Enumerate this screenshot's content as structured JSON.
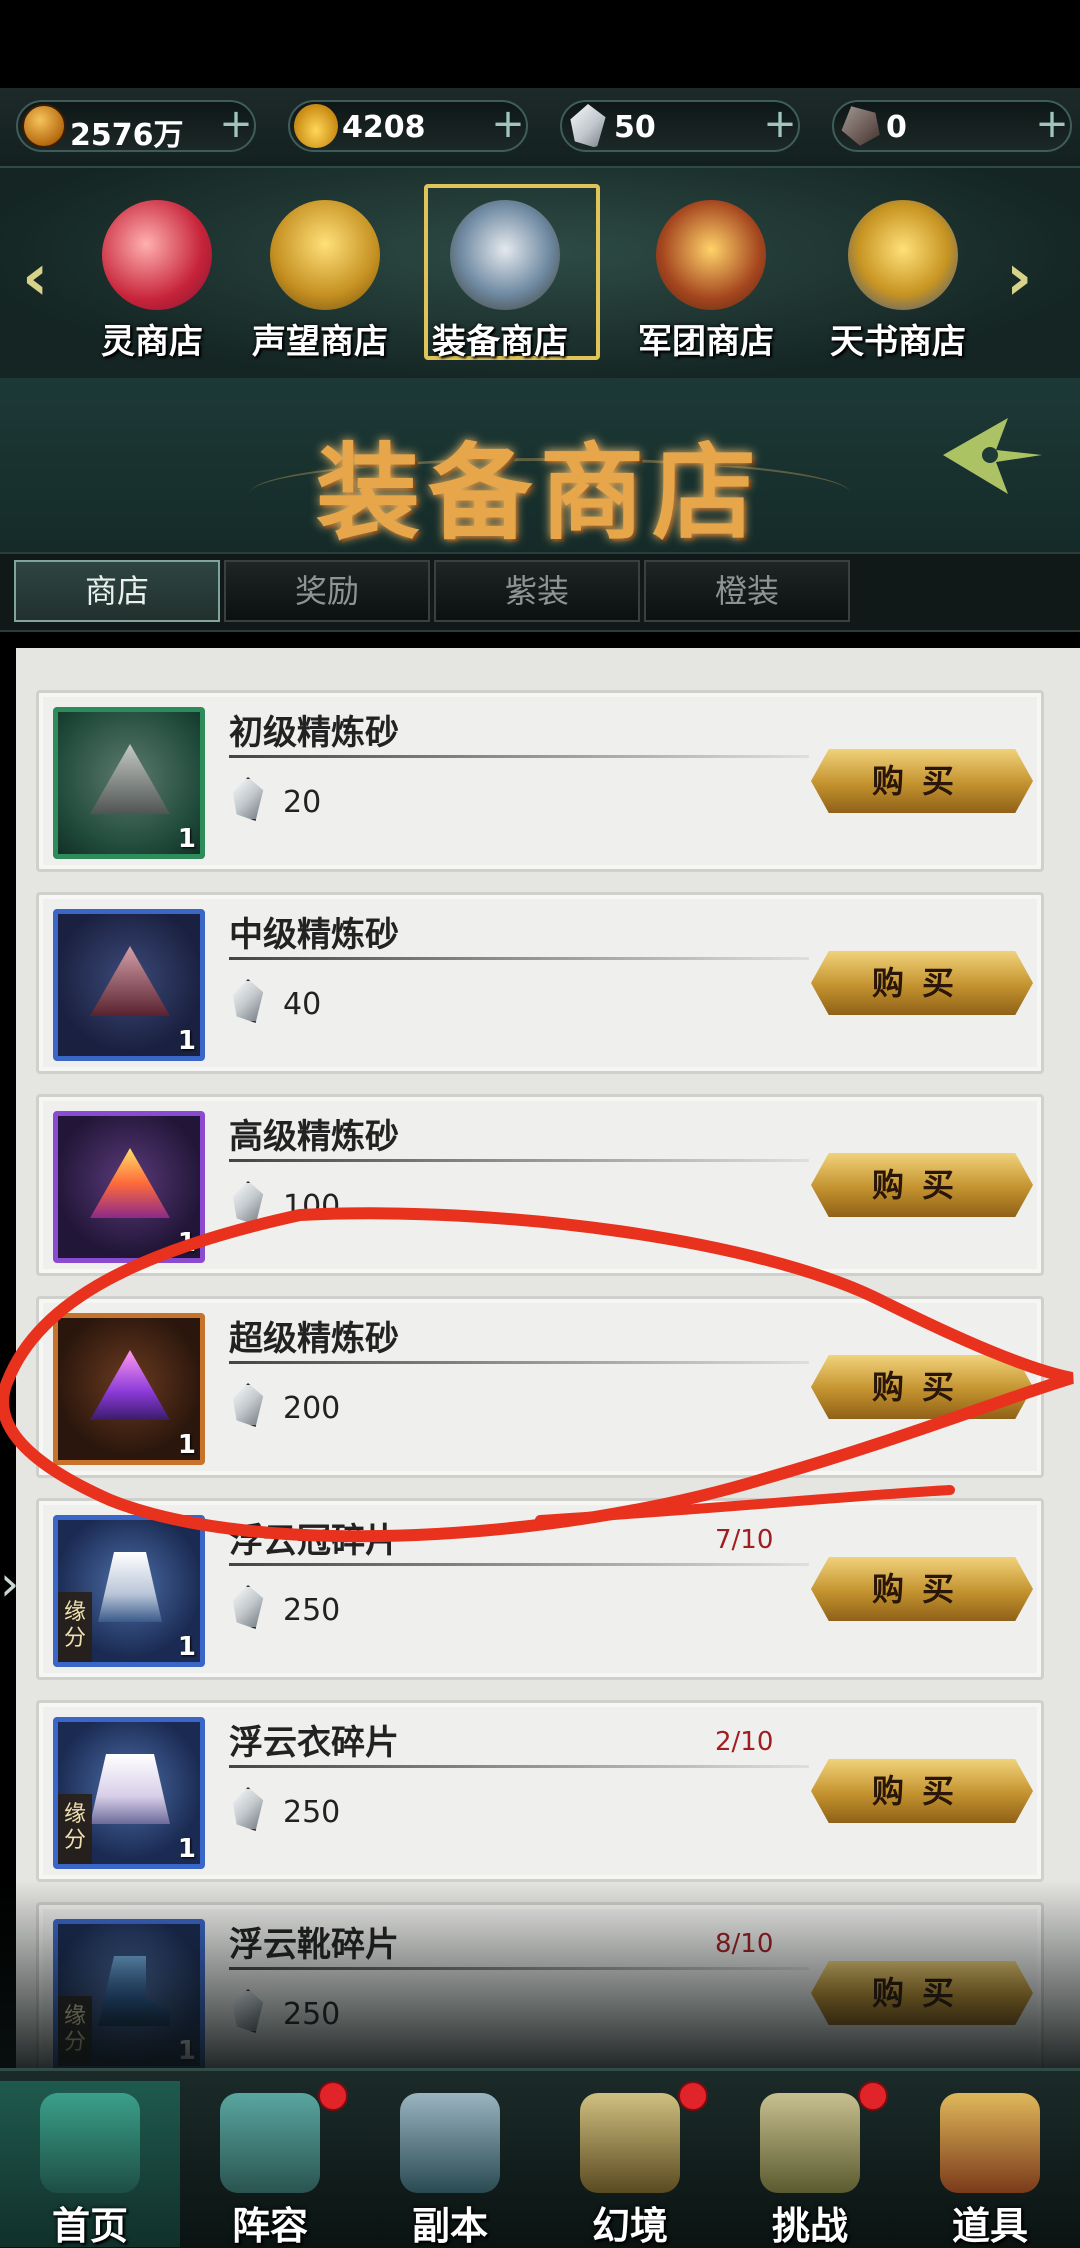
{
  "currencies": [
    {
      "icon": "copper-coin-icon",
      "value": "2576万"
    },
    {
      "icon": "gold-ingot-icon",
      "value": "4208"
    },
    {
      "icon": "refine-crystal-icon",
      "value": "50"
    },
    {
      "icon": "ore-icon",
      "value": "0"
    }
  ],
  "shop_tabs": [
    {
      "label": "灵商店"
    },
    {
      "label": "声望商店"
    },
    {
      "label": "装备商店",
      "selected": true
    },
    {
      "label": "军团商店"
    },
    {
      "label": "天书商店"
    }
  ],
  "banner": {
    "title": "装备商店"
  },
  "sub_tabs": [
    {
      "label": "商店",
      "active": true
    },
    {
      "label": "奖励"
    },
    {
      "label": "紫装"
    },
    {
      "label": "橙装"
    }
  ],
  "items": [
    {
      "name": "初级精炼砂",
      "qty": "1",
      "price": "20",
      "progress": "",
      "fate": "",
      "buy": "购买"
    },
    {
      "name": "中级精炼砂",
      "qty": "1",
      "price": "40",
      "progress": "",
      "fate": "",
      "buy": "购买"
    },
    {
      "name": "高级精炼砂",
      "qty": "1",
      "price": "100",
      "progress": "",
      "fate": "",
      "buy": "购买"
    },
    {
      "name": "超级精炼砂",
      "qty": "1",
      "price": "200",
      "progress": "",
      "fate": "",
      "buy": "购买"
    },
    {
      "name": "浮云冠碎片",
      "qty": "1",
      "price": "250",
      "progress": "7/10",
      "fate": "缘分",
      "buy": "购买"
    },
    {
      "name": "浮云衣碎片",
      "qty": "1",
      "price": "250",
      "progress": "2/10",
      "fate": "缘分",
      "buy": "购买"
    },
    {
      "name": "浮云靴碎片",
      "qty": "1",
      "price": "250",
      "progress": "8/10",
      "fate": "缘分",
      "buy": "购买"
    }
  ],
  "bottom_nav": [
    {
      "label": "首页",
      "icon": "home-icon",
      "badge": false,
      "active": true
    },
    {
      "label": "阵容",
      "icon": "lineup-icon",
      "badge": true
    },
    {
      "label": "副本",
      "icon": "sword-icon",
      "badge": false
    },
    {
      "label": "幻境",
      "icon": "crossed-swords-icon",
      "badge": true
    },
    {
      "label": "挑战",
      "icon": "scroll-icon",
      "badge": true
    },
    {
      "label": "道具",
      "icon": "bag-icon",
      "badge": false
    }
  ],
  "colors": {
    "accent_gold": "#e0c45a",
    "progress_red": "#a01e22",
    "annotation_red": "#e8321e"
  }
}
